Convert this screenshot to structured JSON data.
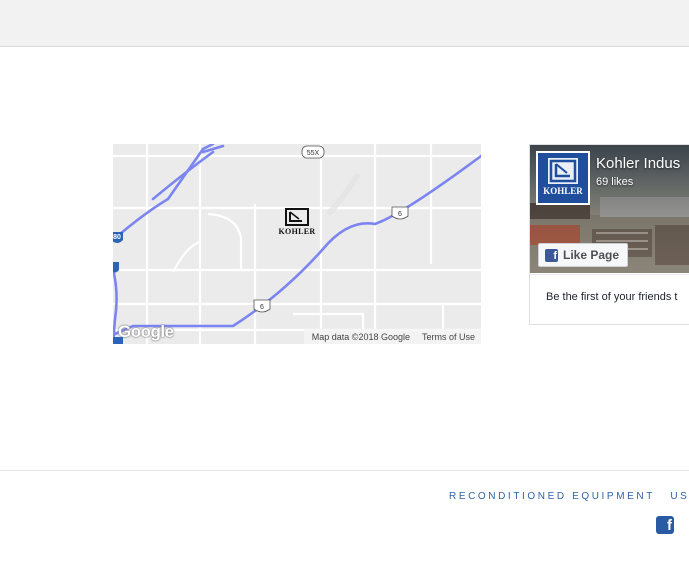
{
  "map": {
    "route_labels": [
      "55X",
      "6",
      "6",
      "80"
    ],
    "marker_label": "KOHLER",
    "google_logo": "Google",
    "attribution": "Map data ©2018 Google",
    "terms": "Terms of Use"
  },
  "facebook": {
    "page_name": "Kohler Indus",
    "likes": "69 likes",
    "like_button": "Like Page",
    "avatar_text": "KOHLER",
    "friends_text": "Be the first of your friends t"
  },
  "footer": {
    "nav": [
      "RECONDITIONED EQUIPMENT",
      "USED"
    ],
    "social_icon": "facebook-square-icon"
  },
  "colors": {
    "accent": "#2f63a6",
    "route": "#7b85f0",
    "facebook": "#3b5998"
  }
}
